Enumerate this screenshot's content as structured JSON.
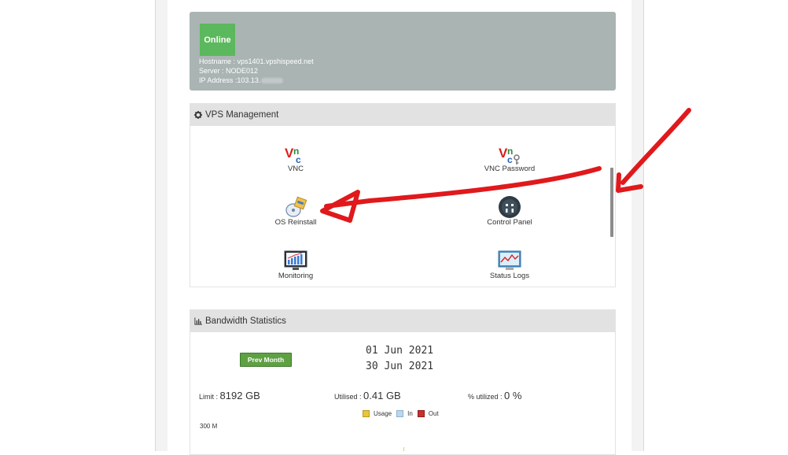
{
  "status": {
    "badge": "Online",
    "hostname": "Hostname : vps1401.vpshispeed.net",
    "server": "Server : NODE012",
    "ip": "IP Address :103.13.",
    "badge_color": "#5cb85c"
  },
  "vps_management": {
    "title": "VPS Management",
    "items": [
      {
        "label": "VNC",
        "icon": "vnc-icon"
      },
      {
        "label": "VNC Password",
        "icon": "vnc-password-icon"
      },
      {
        "label": "OS Reinstall",
        "icon": "os-reinstall-icon"
      },
      {
        "label": "Control Panel",
        "icon": "control-panel-icon"
      },
      {
        "label": "Monitoring",
        "icon": "monitoring-icon"
      },
      {
        "label": "Status Logs",
        "icon": "status-logs-icon"
      }
    ]
  },
  "bandwidth": {
    "title": "Bandwidth Statistics",
    "prev_button": "Prev Month",
    "start_date": "01 Jun 2021",
    "end_date": "30 Jun 2021",
    "limit_label": "Limit :",
    "limit_value": "8192 GB",
    "utilised_label": "Utilised :",
    "utilised_value": "0.41 GB",
    "utilized_label": "% utilized :",
    "utilized_value": "0 %",
    "legend": [
      {
        "label": "Usage",
        "color": "#e8c53a"
      },
      {
        "label": "In",
        "color": "#b9d7ee"
      },
      {
        "label": "Out",
        "color": "#c9302c"
      }
    ],
    "y_axis_top": "300 M"
  },
  "annotation_color": "#e0191c"
}
